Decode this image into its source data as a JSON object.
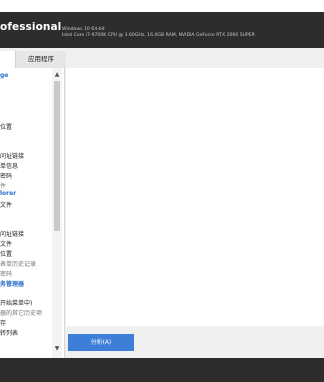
{
  "app": {
    "title_fragment": "ofessional",
    "sysinfo_line1": "Windows 10 64-bit",
    "sysinfo_line2": "Intel Core i7-9700K CPU @ 3.60GHz, 16.0GB RAM, NVIDIA GeForce RTX 2060 SUPER"
  },
  "tabs": {
    "apps_label": "应用程序"
  },
  "panel": {
    "items": [
      {
        "label": "ge",
        "style": "blue"
      },
      {
        "label": "位置",
        "style": "normal"
      },
      {
        "label": "问址链接",
        "style": "normal"
      },
      {
        "label": "单信息",
        "style": "normal"
      },
      {
        "label": "密码",
        "style": "normal"
      },
      {
        "label": "件",
        "style": "gray"
      },
      {
        "label": "lorer",
        "style": "blue"
      },
      {
        "label": "文件",
        "style": "normal"
      },
      {
        "label": "问址链接",
        "style": "normal"
      },
      {
        "label": "文件",
        "style": "normal"
      },
      {
        "label": "位置",
        "style": "normal"
      },
      {
        "label": "表单历史记录",
        "style": "gray"
      },
      {
        "label": "密码",
        "style": "gray"
      },
      {
        "label": "务管理器",
        "style": "blue"
      },
      {
        "label": "开始菜单中)",
        "style": "normal"
      },
      {
        "label": "器的其它历史项",
        "style": "gray"
      },
      {
        "label": "存",
        "style": "normal"
      },
      {
        "label": "转列表",
        "style": "normal"
      }
    ]
  },
  "actions": {
    "analyze_label": "分析(A)"
  }
}
